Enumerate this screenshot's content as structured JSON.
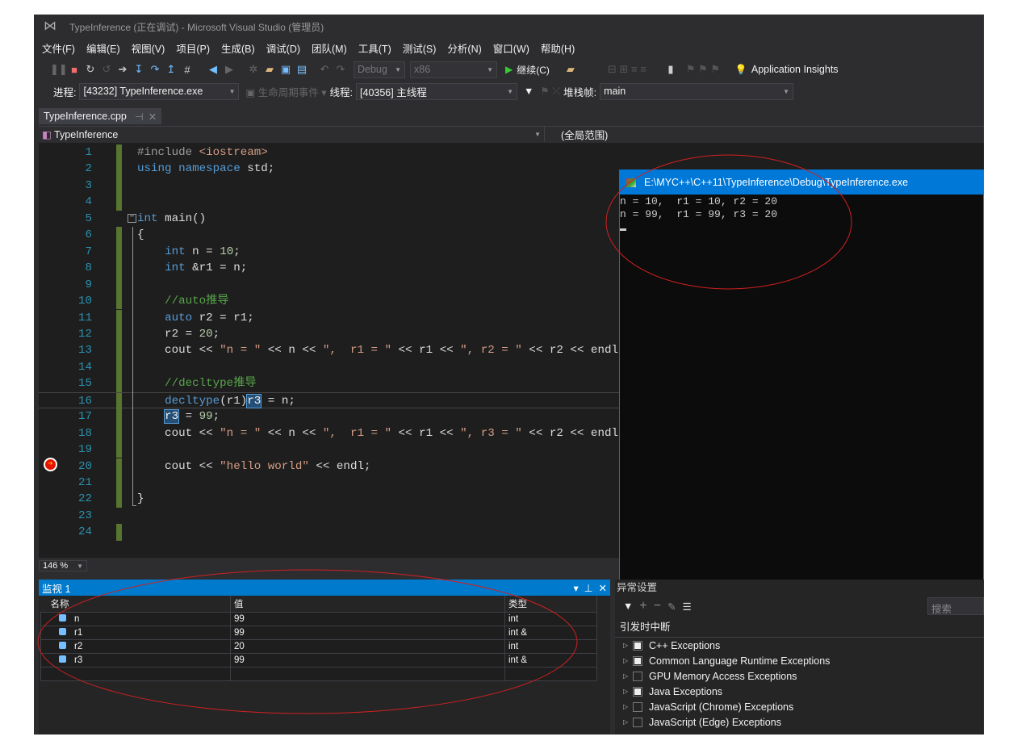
{
  "window": {
    "title": "TypeInference (正在调试) - Microsoft Visual Studio (管理员)"
  },
  "menu": [
    "文件(F)",
    "编辑(E)",
    "视图(V)",
    "项目(P)",
    "生成(B)",
    "调试(D)",
    "团队(M)",
    "工具(T)",
    "测试(S)",
    "分析(N)",
    "窗口(W)",
    "帮助(H)"
  ],
  "toolbar": {
    "config": "Debug",
    "platform": "x86",
    "continue": "继续(C)",
    "insights": "Application Insights"
  },
  "debugbar": {
    "process_label": "进程:",
    "process": "[43232] TypeInference.exe",
    "lifecycle": "生命周期事件",
    "thread_label": "线程:",
    "thread": "[40356] 主线程",
    "stack_label": "堆栈帧:",
    "stack": "main"
  },
  "tab": {
    "name": "TypeInference.cpp"
  },
  "navbar": {
    "project": "TypeInference",
    "scope": "(全局范围)"
  },
  "editor": {
    "zoom": "146 %",
    "current_line": 20,
    "lines": [
      [
        [
          "#include ",
          "pp"
        ],
        [
          "<iostream>",
          "str"
        ]
      ],
      [
        [
          "using ",
          "kw"
        ],
        [
          "namespace ",
          "kw"
        ],
        [
          "std;",
          "tx"
        ]
      ],
      [],
      [],
      [
        [
          "int ",
          "kw"
        ],
        [
          "main()",
          "tx"
        ]
      ],
      [
        [
          "{",
          "tx"
        ]
      ],
      [
        [
          "    ",
          "tx"
        ],
        [
          "int ",
          "kw"
        ],
        [
          "n = ",
          "tx"
        ],
        [
          "10",
          "num"
        ],
        [
          ";",
          "tx"
        ]
      ],
      [
        [
          "    ",
          "tx"
        ],
        [
          "int ",
          "kw"
        ],
        [
          "&r1 = n;",
          "tx"
        ]
      ],
      [],
      [
        [
          "    //auto推导",
          "cm"
        ]
      ],
      [
        [
          "    ",
          "tx"
        ],
        [
          "auto ",
          "kw"
        ],
        [
          "r2 = r1;",
          "tx"
        ]
      ],
      [
        [
          "    r2 = ",
          "tx"
        ],
        [
          "20",
          "num"
        ],
        [
          ";",
          "tx"
        ]
      ],
      [
        [
          "    cout << ",
          "tx"
        ],
        [
          "\"n = \"",
          "str"
        ],
        [
          " << n << ",
          "tx"
        ],
        [
          "\",  r1 = \"",
          "str"
        ],
        [
          " << r1 << ",
          "tx"
        ],
        [
          "\", r2 = \"",
          "str"
        ],
        [
          " << r2 << endl;",
          "tx"
        ]
      ],
      [],
      [
        [
          "    //decltype推导",
          "cm"
        ]
      ],
      [
        [
          "    ",
          "tx"
        ],
        [
          "decltype",
          "kw"
        ],
        [
          "(r1)",
          "tx"
        ],
        [
          "r3",
          "hl"
        ],
        [
          " = n;",
          "tx"
        ]
      ],
      [
        [
          "    ",
          "tx"
        ],
        [
          "r3",
          "hl"
        ],
        [
          " = ",
          "tx"
        ],
        [
          "99",
          "num"
        ],
        [
          ";",
          "tx"
        ]
      ],
      [
        [
          "    cout << ",
          "tx"
        ],
        [
          "\"n = \"",
          "str"
        ],
        [
          " << n << ",
          "tx"
        ],
        [
          "\",  r1 = \"",
          "str"
        ],
        [
          " << r1 << ",
          "tx"
        ],
        [
          "\", r3 = \"",
          "str"
        ],
        [
          " << r2 << endl;",
          "tx"
        ]
      ],
      [],
      [
        [
          "    cout << ",
          "tx"
        ],
        [
          "\"hello world\"",
          "str"
        ],
        [
          " << endl;",
          "tx"
        ]
      ],
      [],
      [
        [
          "}",
          "tx"
        ]
      ],
      [],
      []
    ]
  },
  "console": {
    "title": "E:\\MYC++\\C++11\\TypeInference\\Debug\\TypeInference.exe",
    "output": "n = 10,  r1 = 10, r2 = 20\nn = 99,  r1 = 99, r3 = 20"
  },
  "watch": {
    "title": "监视 1",
    "columns": [
      "名称",
      "值",
      "类型"
    ],
    "rows": [
      {
        "name": "n",
        "value": "99",
        "type": "int"
      },
      {
        "name": "r1",
        "value": "99",
        "type": "int &"
      },
      {
        "name": "r2",
        "value": "20",
        "type": "int"
      },
      {
        "name": "r3",
        "value": "99",
        "type": "int &"
      }
    ]
  },
  "exceptions": {
    "title": "异常设置",
    "search_placeholder": "搜索",
    "header": "引发时中断",
    "items": [
      {
        "label": "C++ Exceptions",
        "checked": true
      },
      {
        "label": "Common Language Runtime Exceptions",
        "checked": true
      },
      {
        "label": "GPU Memory Access Exceptions",
        "checked": false
      },
      {
        "label": "Java Exceptions",
        "checked": true
      },
      {
        "label": "JavaScript (Chrome) Exceptions",
        "checked": false
      },
      {
        "label": "JavaScript (Edge) Exceptions",
        "checked": false
      }
    ]
  },
  "colors": {
    "accent": "#007acc",
    "annotation": "#d02020"
  }
}
